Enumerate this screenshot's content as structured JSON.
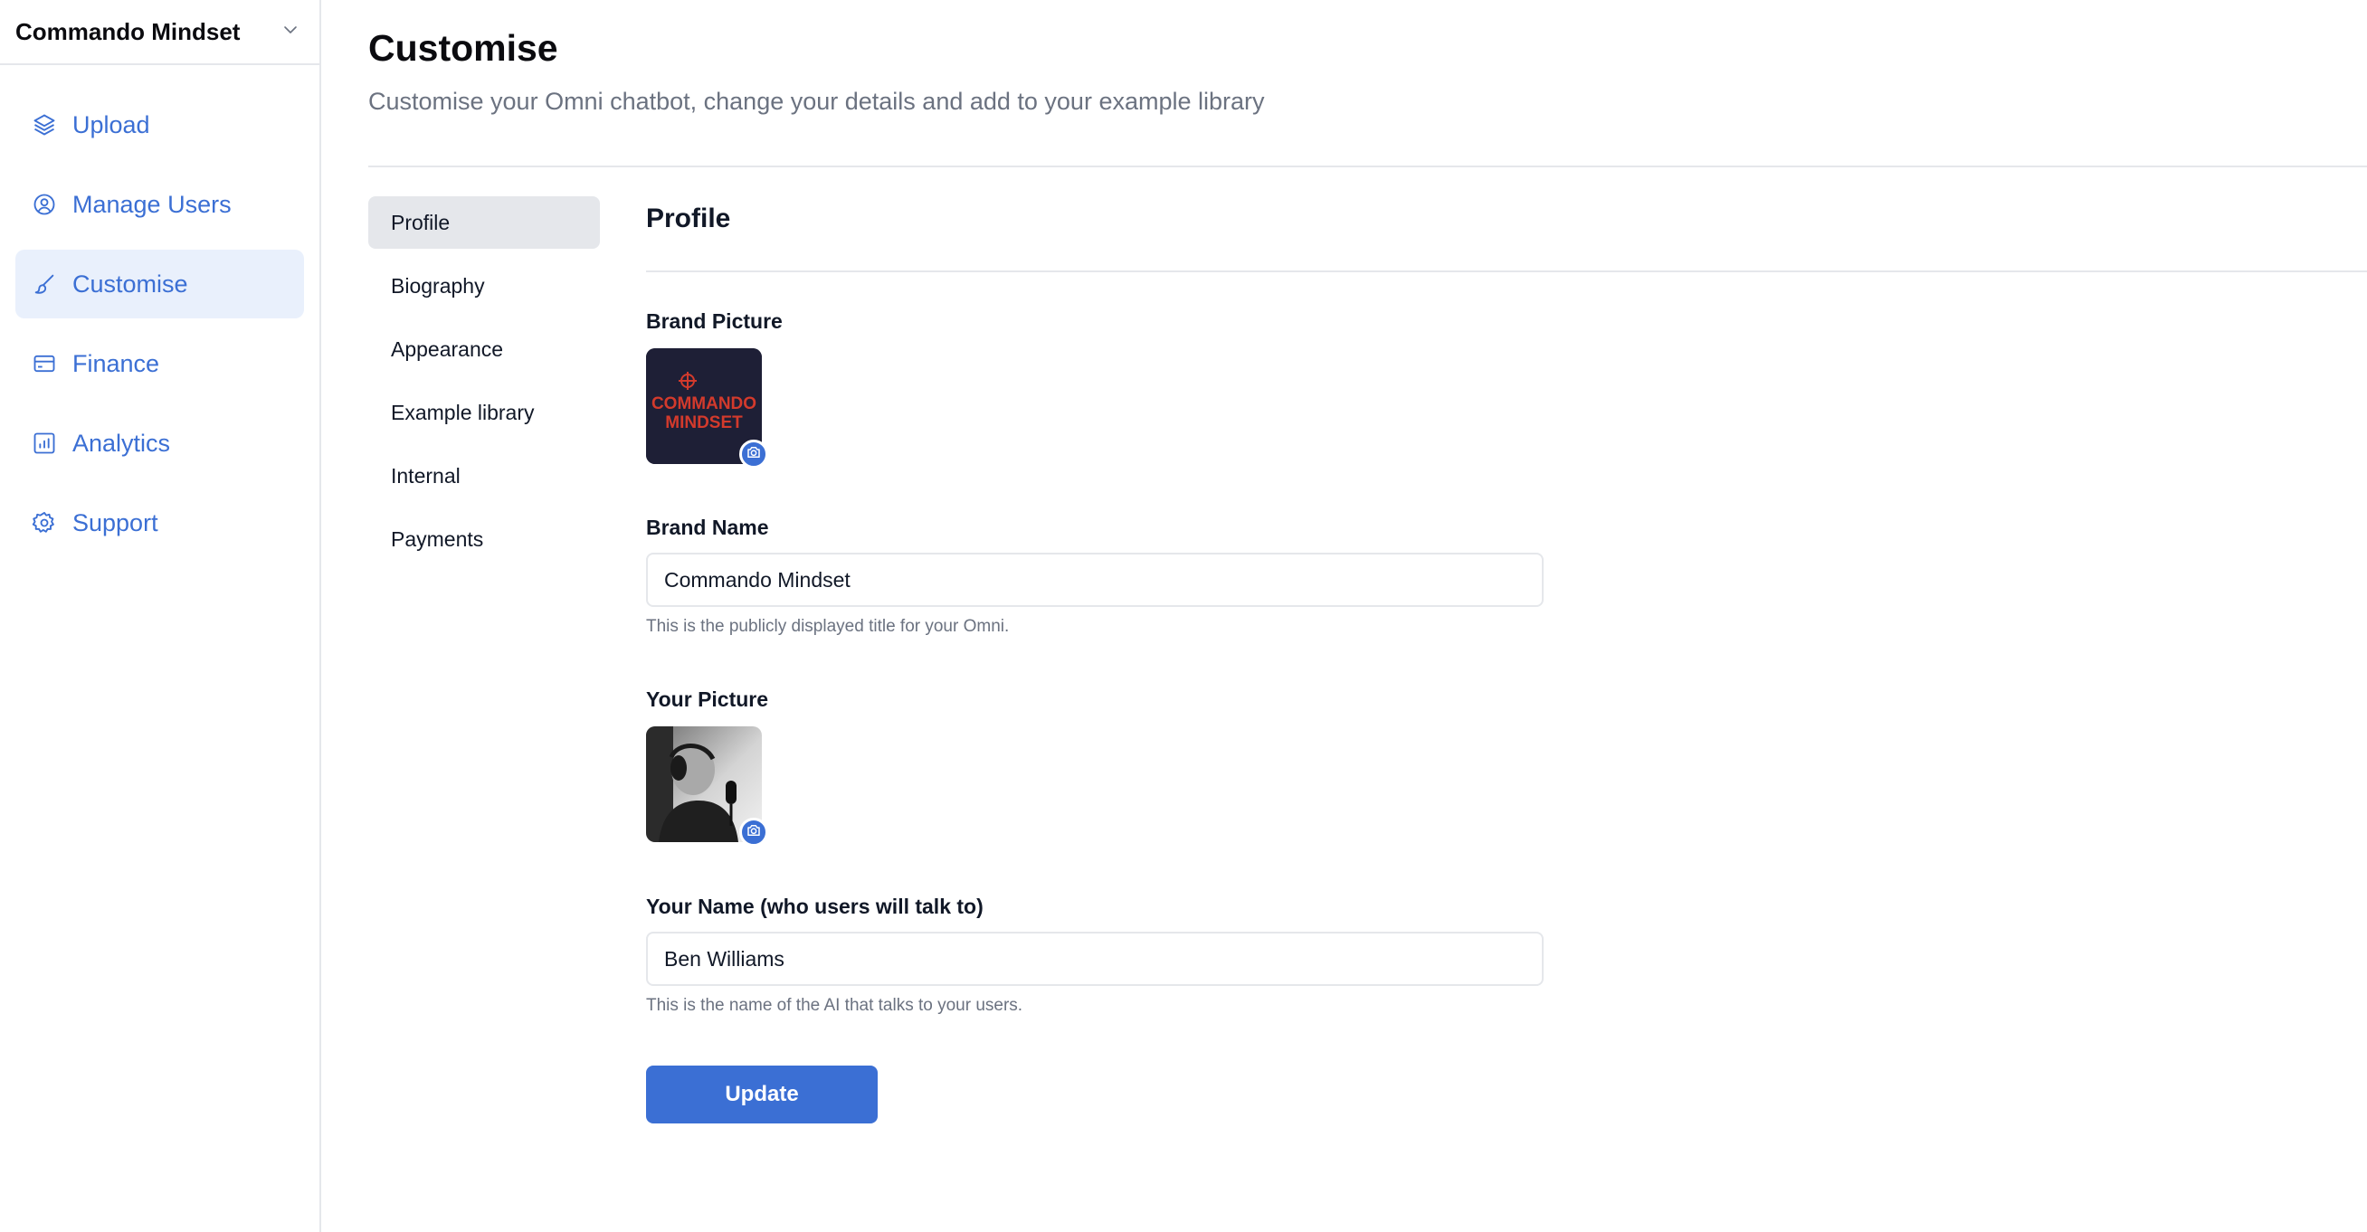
{
  "workspace": {
    "name": "Commando Mindset"
  },
  "sidebar": {
    "items": [
      {
        "label": "Upload",
        "icon": "layers-icon",
        "active": false
      },
      {
        "label": "Manage Users",
        "icon": "user-circle-icon",
        "active": false
      },
      {
        "label": "Customise",
        "icon": "brush-icon",
        "active": true
      },
      {
        "label": "Finance",
        "icon": "credit-card-icon",
        "active": false
      },
      {
        "label": "Analytics",
        "icon": "bar-chart-icon",
        "active": false
      },
      {
        "label": "Support",
        "icon": "gear-icon",
        "active": false
      }
    ]
  },
  "header": {
    "title": "Customise",
    "subtitle": "Customise your Omni chatbot, change your details and add to your example library"
  },
  "subnav": {
    "items": [
      {
        "label": "Profile",
        "active": true
      },
      {
        "label": "Biography",
        "active": false
      },
      {
        "label": "Appearance",
        "active": false
      },
      {
        "label": "Example library",
        "active": false
      },
      {
        "label": "Internal",
        "active": false
      },
      {
        "label": "Payments",
        "active": false
      }
    ]
  },
  "profile": {
    "section_title": "Profile",
    "brand_picture": {
      "label": "Brand Picture",
      "logo_lines": [
        "COMMANDO",
        "MINDSET"
      ]
    },
    "brand_name": {
      "label": "Brand Name",
      "value": "Commando Mindset",
      "hint": "This is the publicly displayed title for your Omni."
    },
    "your_picture": {
      "label": "Your Picture"
    },
    "your_name": {
      "label": "Your Name (who users will talk to)",
      "value": "Ben Williams",
      "hint": "This is the name of the AI that talks to your users."
    },
    "update_label": "Update"
  },
  "colors": {
    "accent": "#3b6fd4",
    "active_nav_bg": "#e9f0fc",
    "logo_bg": "#1e1f36",
    "logo_red": "#d33a2c"
  }
}
